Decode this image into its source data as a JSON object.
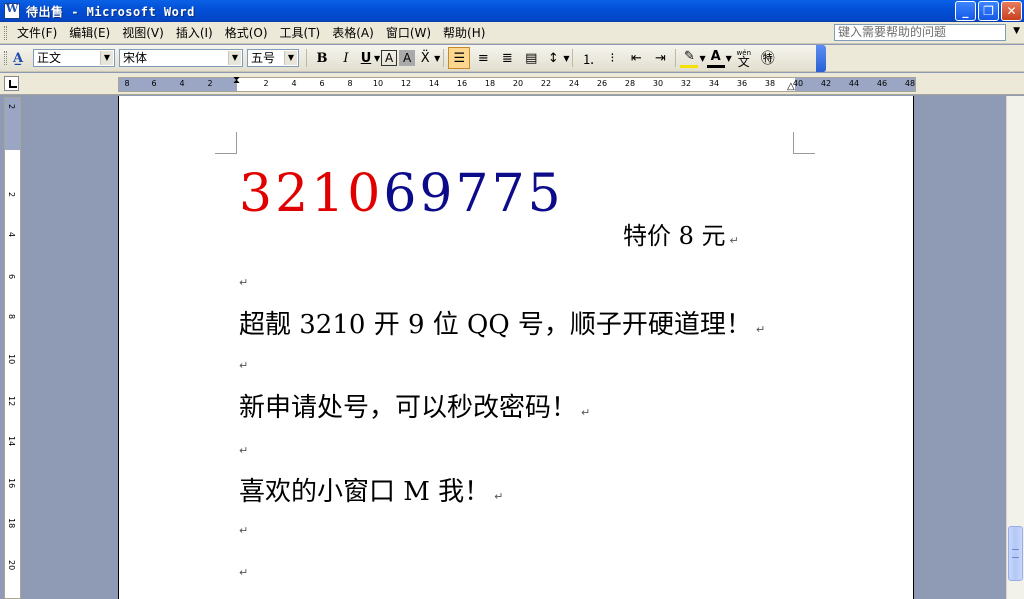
{
  "window": {
    "title": "待出售 - Microsoft Word"
  },
  "menu": [
    "文件(F)",
    "编辑(E)",
    "视图(V)",
    "插入(I)",
    "格式(O)",
    "工具(T)",
    "表格(A)",
    "窗口(W)",
    "帮助(H)"
  ],
  "help_box": {
    "placeholder": "键入需要帮助的问题"
  },
  "toolbar": {
    "style": "正文",
    "font": "宋体",
    "size": "五号",
    "bold": "B",
    "italic": "I",
    "underline": "U",
    "char_border": "A",
    "char_shading": "A",
    "phonetic": "wén"
  },
  "ruler": {
    "h_ticks": [
      "8",
      "6",
      "4",
      "2",
      "2",
      "4",
      "6",
      "8",
      "10",
      "12",
      "14",
      "16",
      "18",
      "20",
      "22",
      "24",
      "26",
      "28",
      "30",
      "32",
      "34",
      "36",
      "38",
      "40",
      "42",
      "44",
      "46",
      "48"
    ],
    "v_ticks": [
      "2",
      "2",
      "4",
      "6",
      "8",
      "10",
      "12",
      "14",
      "16",
      "18",
      "20"
    ]
  },
  "document": {
    "number_red": "3210",
    "number_blue": "69775",
    "price": "特价 8 元",
    "lines": [
      "超靓 3210 开 9 位 QQ 号，顺子开硬道理！",
      "新申请处号，可以秒改密码！",
      "喜欢的小窗口 M 我！"
    ],
    "paragraph_mark": "↵"
  },
  "colors": {
    "red_digits": "#e00000",
    "blue_digits": "#0c0c8a",
    "titlebar": "#0350d6"
  }
}
